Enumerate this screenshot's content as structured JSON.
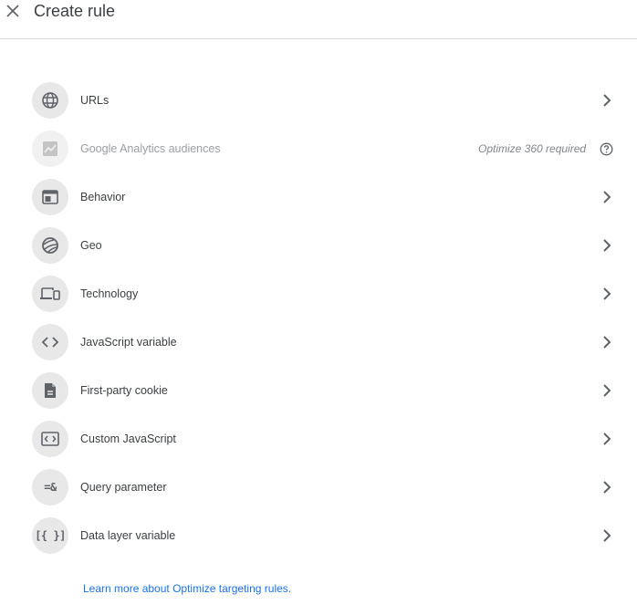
{
  "header": {
    "title": "Create rule",
    "close_icon": "close-icon"
  },
  "rules": [
    {
      "label": "URLs",
      "icon": "globe-icon",
      "enabled": true
    },
    {
      "label": "Google Analytics audiences",
      "icon": "trending-chart-icon",
      "enabled": false,
      "note": "Optimize 360 required",
      "note_icon": "help-circle-icon"
    },
    {
      "label": "Behavior",
      "icon": "browser-window-icon",
      "enabled": true
    },
    {
      "label": "Geo",
      "icon": "earth-icon",
      "enabled": true
    },
    {
      "label": "Technology",
      "icon": "devices-icon",
      "enabled": true
    },
    {
      "label": "JavaScript variable",
      "icon": "code-brackets-icon",
      "enabled": true
    },
    {
      "label": "First-party cookie",
      "icon": "document-icon",
      "enabled": true
    },
    {
      "label": "Custom JavaScript",
      "icon": "custom-script-icon",
      "enabled": true
    },
    {
      "label": "Query parameter",
      "icon": "query-param-icon",
      "icon_text": "=&",
      "enabled": true
    },
    {
      "label": "Data layer variable",
      "icon": "data-layer-icon",
      "icon_text": "[{ }]",
      "enabled": true
    }
  ],
  "footer": {
    "learn_more": "Learn more about Optimize targeting rules."
  },
  "colors": {
    "link": "#1a73e8",
    "icon": "#5f6368",
    "icon_bg": "#e8e8e8",
    "disabled_text": "#9aa0a6"
  }
}
